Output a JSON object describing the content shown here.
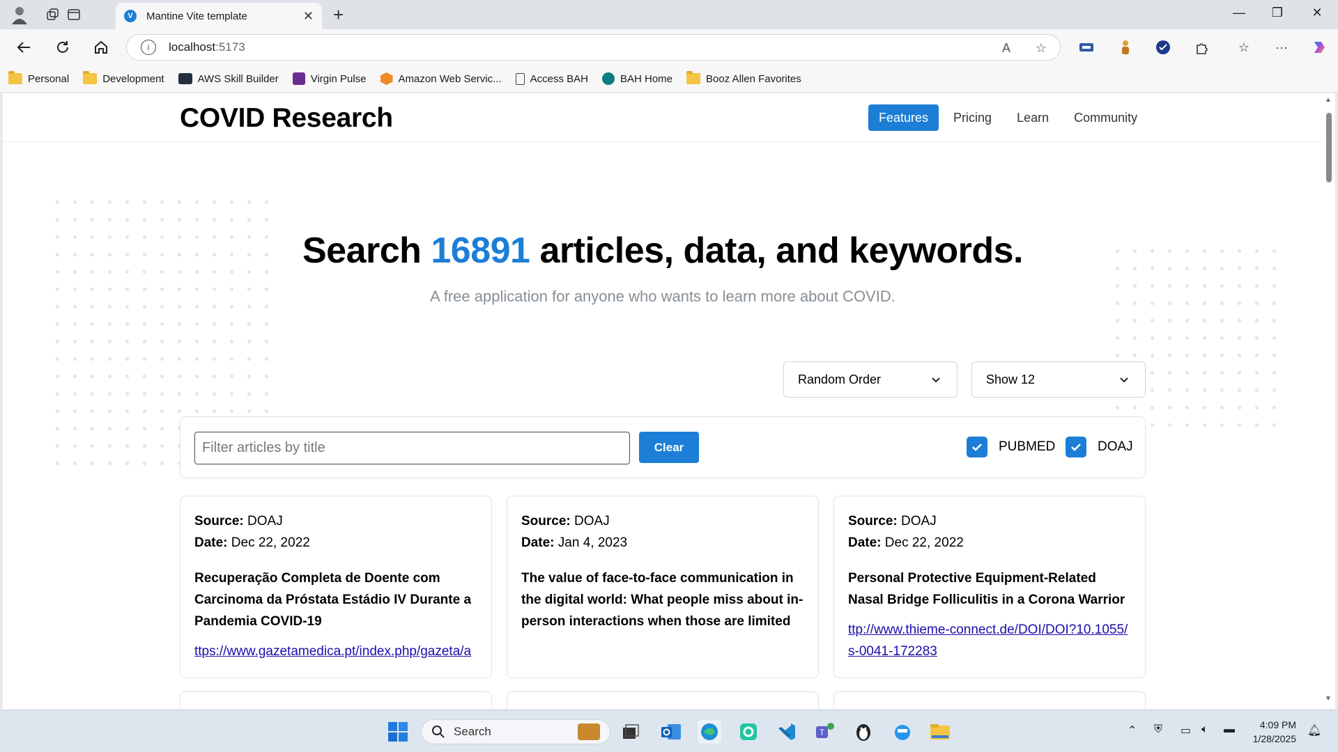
{
  "browser": {
    "tab_title": "Mantine Vite template",
    "url_host": "localhost",
    "url_port": ":5173",
    "bookmarks": [
      {
        "label": "Personal",
        "icon": "folder-icon"
      },
      {
        "label": "Development",
        "icon": "folder-icon"
      },
      {
        "label": "AWS Skill Builder",
        "icon": "aws-icon"
      },
      {
        "label": "Virgin Pulse",
        "icon": "virgin-pulse-icon"
      },
      {
        "label": "Amazon Web Servic...",
        "icon": "aws-cube-icon"
      },
      {
        "label": "Access BAH",
        "icon": "document-icon"
      },
      {
        "label": "BAH Home",
        "icon": "sharepoint-icon"
      },
      {
        "label": "Booz Allen Favorites",
        "icon": "folder-icon"
      }
    ]
  },
  "header": {
    "brand": "COVID Research",
    "nav": [
      {
        "label": "Features",
        "active": true
      },
      {
        "label": "Pricing",
        "active": false
      },
      {
        "label": "Learn",
        "active": false
      },
      {
        "label": "Community",
        "active": false
      }
    ]
  },
  "hero": {
    "title_prefix": "Search",
    "count": "16891",
    "title_suffix": "articles, data, and keywords.",
    "subtitle": "A free application for anyone who wants to learn more about COVID."
  },
  "controls": {
    "order_value": "Random Order",
    "show_value": "Show 12",
    "filter_placeholder": "Filter articles by title",
    "clear_label": "Clear",
    "sources": [
      {
        "label": "PUBMED",
        "checked": true
      },
      {
        "label": "DOAJ",
        "checked": true
      }
    ]
  },
  "labels": {
    "source": "Source:",
    "date": "Date:"
  },
  "articles": [
    {
      "source": "DOAJ",
      "date": "Dec 22, 2022",
      "title": "Recuperação Completa de Doente com Carcinoma da Próstata Estádio IV Durante a Pandemia COVID-19",
      "link": "ttps://www.gazetamedica.pt/index.php/gazeta/a"
    },
    {
      "source": "DOAJ",
      "date": "Jan 4, 2023",
      "title": "The value of face-to-face communication in the digital world: What people miss about in-person interactions when those are limited",
      "link": ""
    },
    {
      "source": "DOAJ",
      "date": "Dec 22, 2022",
      "title": "Personal Protective Equipment-Related Nasal Bridge Folliculitis in a Corona Warrior",
      "link": "ttp://www.thieme-connect.de/DOI/DOI?10.1055/s-0041-172283"
    }
  ],
  "taskbar": {
    "search_label": "Search",
    "time": "4:09 PM",
    "date": "1/28/2025"
  },
  "colors": {
    "accent": "#1c7ed6",
    "link": "#1a0dab",
    "muted": "#868e96"
  }
}
